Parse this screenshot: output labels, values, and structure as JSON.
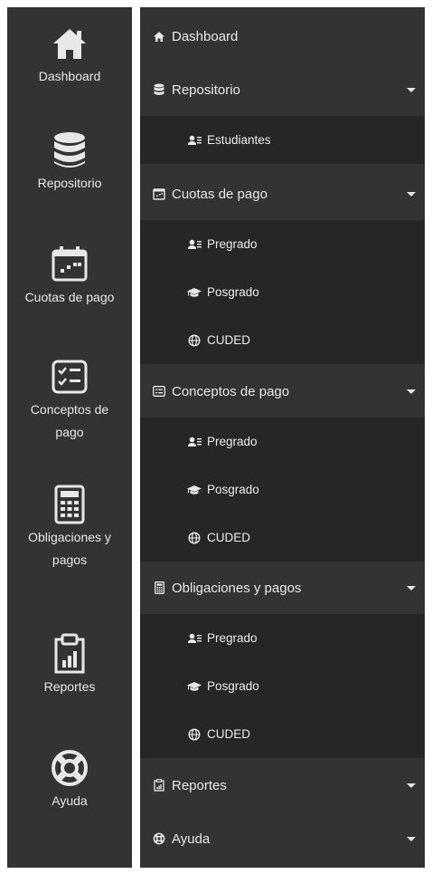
{
  "colors": {
    "rail_bg": "#333333",
    "panel_bg": "#333333",
    "sub_bg": "#262626",
    "text": "#e8e8e8"
  },
  "rail": {
    "items": [
      {
        "label": "Dashboard",
        "icon": "home-icon"
      },
      {
        "label": "Repositorio",
        "icon": "database-icon"
      },
      {
        "label": "Cuotas de pago",
        "icon": "calendar-icon"
      },
      {
        "label": "Conceptos de pago",
        "icon": "checklist-icon"
      },
      {
        "label": "Obligaciones y pagos",
        "icon": "calculator-icon"
      },
      {
        "label": "Reportes",
        "icon": "report-icon"
      },
      {
        "label": "Ayuda",
        "icon": "lifebuoy-icon"
      }
    ]
  },
  "menu": {
    "dashboard": "Dashboard",
    "repositorio": {
      "label": "Repositorio",
      "items": [
        "Estudiantes"
      ]
    },
    "cuotas": {
      "label": "Cuotas de pago",
      "items": [
        "Pregrado",
        "Posgrado",
        "CUDED"
      ]
    },
    "conceptos": {
      "label": "Conceptos de pago",
      "items": [
        "Pregrado",
        "Posgrado",
        "CUDED"
      ]
    },
    "obligaciones": {
      "label": "Obligaciones y pagos",
      "items": [
        "Pregrado",
        "Posgrado",
        "CUDED"
      ]
    },
    "reportes": "Reportes",
    "ayuda": "Ayuda"
  }
}
